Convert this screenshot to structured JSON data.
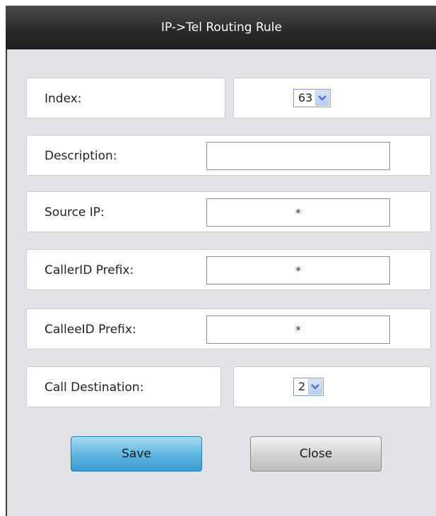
{
  "dialog": {
    "title": "IP->Tel Routing Rule"
  },
  "form": {
    "index": {
      "label": "Index:",
      "value": "63"
    },
    "description": {
      "label": "Description:",
      "value": ""
    },
    "source_ip": {
      "label": "Source IP:",
      "value": "*"
    },
    "callerid_prefix": {
      "label": "CallerID Prefix:",
      "value": "*"
    },
    "calleeid_prefix": {
      "label": "CalleeID Prefix:",
      "value": "*"
    },
    "call_destination": {
      "label": "Call Destination:",
      "value": "2"
    }
  },
  "buttons": {
    "save_label": "Save",
    "close_label": "Close"
  },
  "colors": {
    "titlebar": "#2a2a2a",
    "panel": "#e1e3e6",
    "save_accent": "#62b7e3",
    "select_arrow": "#4a78c8"
  }
}
